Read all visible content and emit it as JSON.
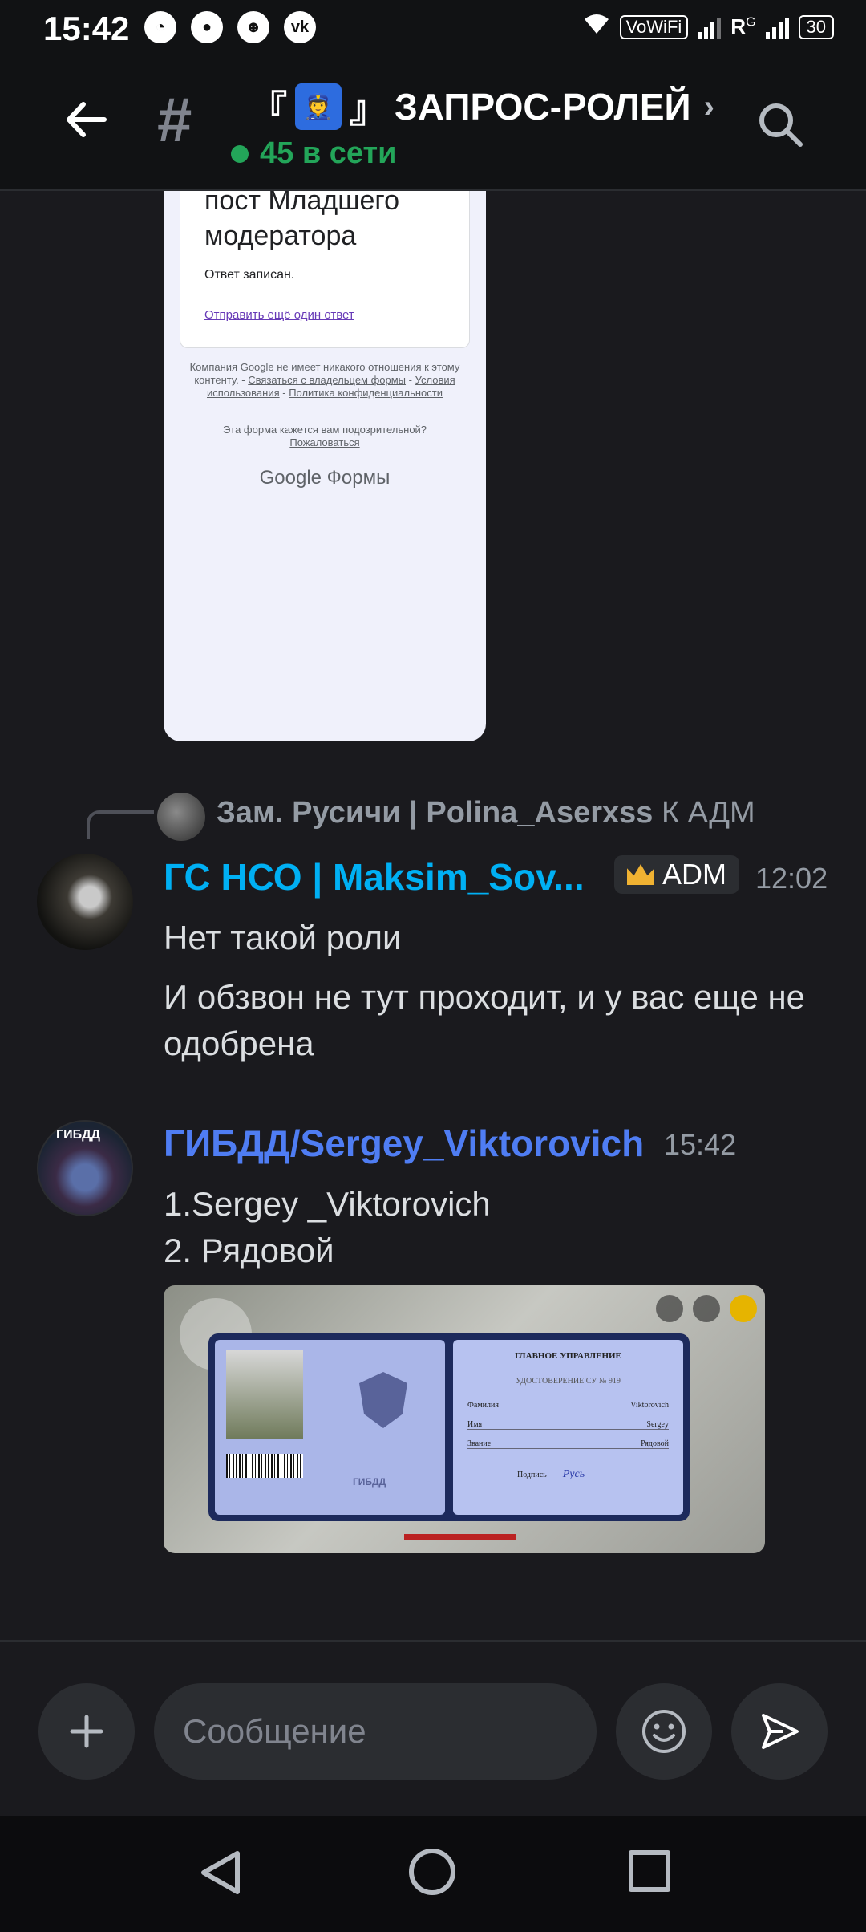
{
  "status_bar": {
    "time": "15:42",
    "app_icons": [
      "chat-bubble-icon",
      "message-icon",
      "face-icon",
      "vk-icon"
    ],
    "vowifi": "VoWiFi",
    "roaming": "R",
    "network_g": "G",
    "battery": "30"
  },
  "header": {
    "channel_name": "ЗАПРОС-РОЛЕЙ",
    "bracket_open": "『",
    "bracket_close": "』",
    "online_text": "45 в сети",
    "online_color": "#23a559"
  },
  "google_form": {
    "heading": "пост Младшего модератора",
    "recorded": "Ответ записан.",
    "send_another": "Отправить ещё один ответ",
    "footer_line1": "Компания Google не имеет никакого отношения к этому контенту. -",
    "footer_link1": "Связаться с владельцем формы",
    "footer_link2": "Условия использования",
    "footer_link3": "Политика конфиденциальности",
    "suspicious": "Эта форма кажется вам подозрительной?",
    "report": "Пожаловаться",
    "brand_google": "Google",
    "brand_forms": "Формы"
  },
  "reply": {
    "author": "Зам. Русичи | Polina_Aserxss",
    "text": "К АДМ"
  },
  "messages": [
    {
      "author": "ГС НСО | Maksim_Sov...",
      "author_color": "#00b0f4",
      "badge": "ADM",
      "time": "12:02",
      "lines": [
        "Нет такой роли",
        "И обзвон не тут проходит, и у вас еще не одобрена"
      ]
    },
    {
      "author": "ГИБДД/Sergey_Viktorovich",
      "author_color": "#4f7df3",
      "time": "15:42",
      "lines": [
        "1.Sergey _Viktorovich",
        "2. Рядовой"
      ]
    }
  ],
  "game_card": {
    "title": "ГЛАВНОЕ УПРАВЛЕНИЕ",
    "cert": "УДОСТОВЕРЕНИЕ СУ № 919",
    "rows": [
      {
        "label": "Фамилия",
        "value": "Viktorovich"
      },
      {
        "label": "Имя",
        "value": "Sergey"
      },
      {
        "label": "Звание",
        "value": "Рядовой"
      }
    ],
    "sign_label": "Подпись",
    "signature": "Русь",
    "emblem_text": "ГИБДД"
  },
  "composer": {
    "placeholder": "Сообщение"
  },
  "colors": {
    "background": "#1a1a1e",
    "header": "#111214",
    "muted": "#949ba4"
  }
}
